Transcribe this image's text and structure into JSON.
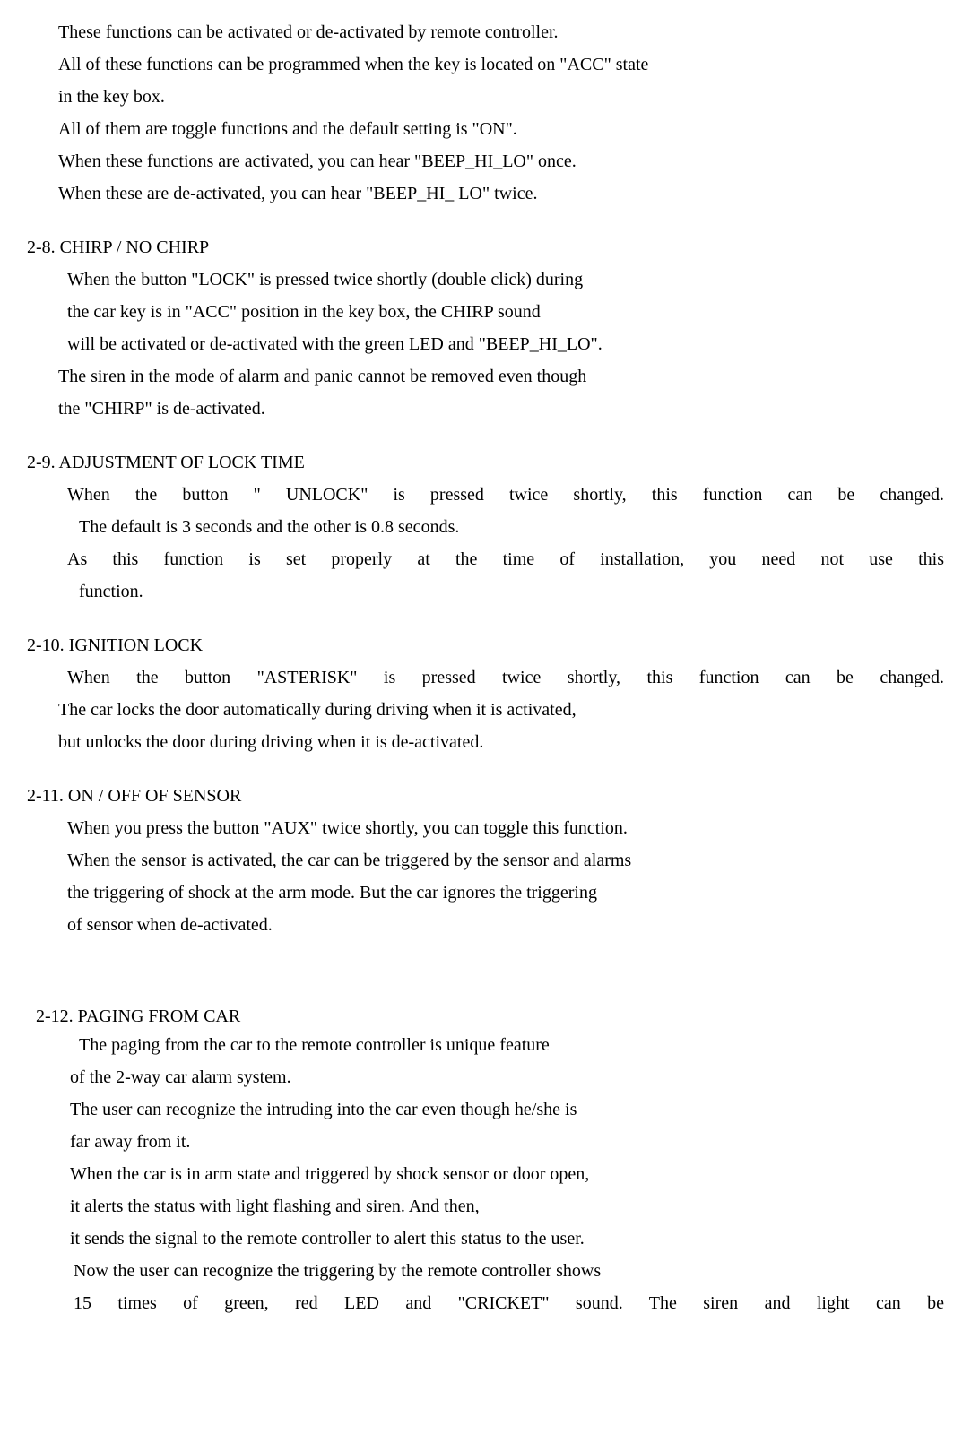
{
  "intro": {
    "p1": "These functions can be activated or de-activated by remote controller.",
    "p2": "All of these functions can be programmed when the key is located on \"ACC\" state",
    "p3": "in the key box.",
    "p4": "All of them are toggle functions and the default setting is \"ON\".",
    "p5": "When these functions are activated, you can hear \"BEEP_HI_LO\" once.",
    "p6": "When these are de-activated, you can hear \"BEEP_HI_ LO\" twice."
  },
  "s28": {
    "heading": "2-8.   CHIRP / NO CHIRP",
    "l1": "When the button \"LOCK\" is pressed twice shortly (double click) during",
    "l2": "the car key is in \"ACC\" position in the key box, the CHIRP sound",
    "l3": "will be activated or de-activated with the green LED and \"BEEP_HI_LO\".",
    "l4": "The siren in the mode of alarm and panic cannot be removed even though",
    "l5": "the \"CHIRP\" is de-activated."
  },
  "s29": {
    "heading": "2-9.   ADJUSTMENT OF LOCK TIME",
    "l1": "When the button \" UNLOCK\" is pressed twice shortly, this function can be changed.",
    "l2": "The default is 3 seconds and the other is 0.8 seconds.",
    "l3": "As this function is set properly at the time of installation, you need not use this",
    "l4": "function."
  },
  "s210": {
    "heading": "2-10.  IGNITION LOCK",
    "l1": "When the button \"ASTERISK\" is pressed twice shortly, this function can be changed.",
    "l2": "The car locks the door automatically during driving when it is activated,",
    "l3": "but unlocks the door during driving when it is de-activated."
  },
  "s211": {
    "heading": "2-11.  ON / OFF OF SENSOR",
    "l1": "When you press the button \"AUX\" twice shortly, you can toggle this function.",
    "l2": "When the sensor is activated, the car can be triggered by the sensor and alarms",
    "l3": "the triggering of shock at the arm mode. But the car ignores the triggering",
    "l4": "of sensor when de-activated."
  },
  "s212": {
    "heading": "2-12. PAGING FROM CAR",
    "l1": "The paging from the car to the remote controller is unique feature",
    "l2": "of the 2-way car alarm system.",
    "l3": "The user can recognize the intruding into the car even though he/she is",
    "l4": "far away from it.",
    "l5": "When the car is in arm state and triggered by shock sensor or door open,",
    "l6": "it alerts the status with light flashing and siren. And then,",
    "l7": "it sends the signal to the remote controller to alert this status to the user.",
    "l8": "Now the user can recognize the triggering by the remote controller shows",
    "l9": "15 times of green, red LED and \"CRICKET\" sound. The siren and light can be"
  }
}
